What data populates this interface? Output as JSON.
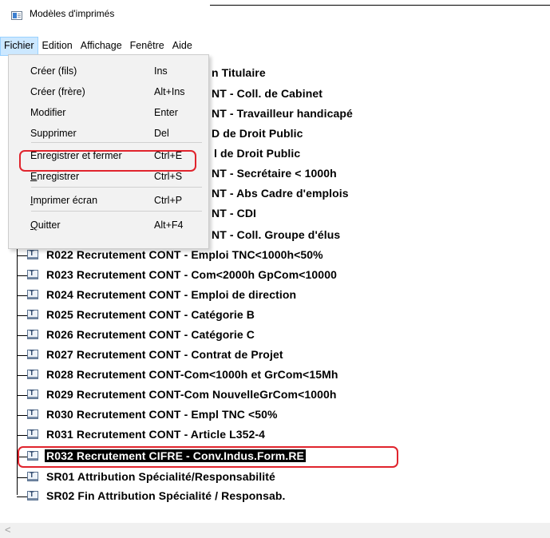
{
  "window": {
    "title": "Modèles d'imprimés"
  },
  "menubar": [
    "Fichier",
    "Edition",
    "Affichage",
    "Fenêtre",
    "Aide"
  ],
  "dropdown": {
    "items": [
      {
        "label": "Créer (fils)",
        "shortcut": "Ins"
      },
      {
        "label": "Créer (frère)",
        "shortcut": "Alt+Ins"
      },
      {
        "label": "Modifier",
        "shortcut": "Enter"
      },
      {
        "label": "Supprimer",
        "shortcut": "Del"
      },
      {
        "label": "Enregistrer et fermer",
        "shortcut": "Ctrl+E"
      },
      {
        "label_u": "E",
        "label_rest": "nregistrer",
        "shortcut": "Ctrl+S"
      },
      {
        "label_u": "I",
        "label_rest": "mprimer écran",
        "shortcut": "Ctrl+P"
      },
      {
        "label_u": "Q",
        "label_rest": "uitter",
        "shortcut": "Alt+F4"
      }
    ]
  },
  "tree": {
    "partial_rows": [
      "n Titulaire",
      "NT - Coll. de Cabinet",
      "NT - Travailleur handicapé",
      "D de Droit Public",
      "l de Droit Public",
      "NT - Secrétaire < 1000h",
      "NT - Abs Cadre d'emplois",
      "NT - CDI",
      "NT - Coll. Groupe d'élus"
    ],
    "rows": [
      "R022 Recrutement CONT - Emploi TNC<1000h<50%",
      "R023 Recrutement CONT - Com<2000h GpCom<10000",
      "R024 Recrutement CONT - Emploi de direction",
      "R025 Recrutement CONT - Catégorie B",
      "R026 Recrutement CONT - Catégorie C",
      "R027 Recrutement CONT - Contrat de Projet",
      "R028 Recrutement CONT-Com<1000h et GrCom<15Mh",
      "R029 Recrutement CONT-Com NouvelleGrCom<1000h",
      "R030 Recrutement CONT - Empl TNC <50%",
      "R031 Recrutement CONT - Article L352-4",
      "R032 Recrutement CIFRE - Conv.Indus.Form.RE",
      "SR01 Attribution Spécialité/Responsabilité",
      "SR02 Fin Attribution Spécialité / Responsab."
    ],
    "selected_index": 10
  },
  "scrollbar": {
    "left_arrow": "<"
  }
}
